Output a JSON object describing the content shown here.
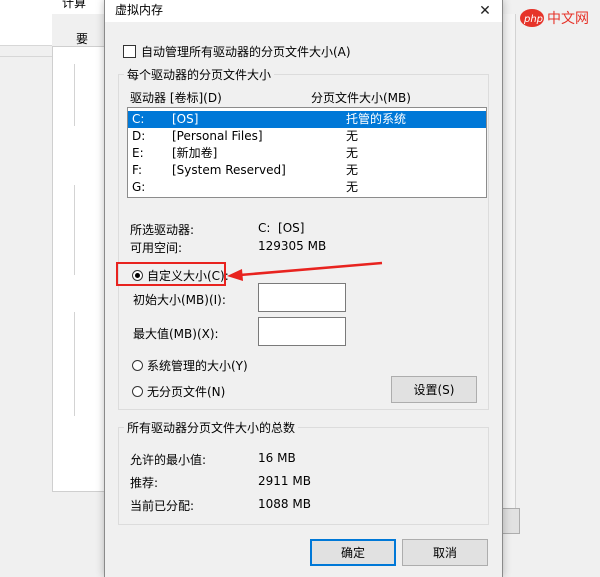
{
  "background_window": {
    "title_fragment": "计算",
    "side_fragment": "要"
  },
  "dialog": {
    "title": "虚拟内存",
    "close_label": "✕",
    "auto_manage": {
      "label": "自动管理所有驱动器的分页文件大小(A)",
      "checked": false
    },
    "per_drive_group": {
      "legend": "每个驱动器的分页文件大小",
      "col_drive": "驱动器 [卷标](D)",
      "col_size": "分页文件大小(MB)",
      "drives": [
        {
          "letter": "C:",
          "label": "[OS]",
          "size": "托管的系统",
          "selected": true
        },
        {
          "letter": "D:",
          "label": "[Personal Files]",
          "size": "无",
          "selected": false
        },
        {
          "letter": "E:",
          "label": "[新加卷]",
          "size": "无",
          "selected": false
        },
        {
          "letter": "F:",
          "label": "[System Reserved]",
          "size": "无",
          "selected": false
        },
        {
          "letter": "G:",
          "label": "",
          "size": "无",
          "selected": false
        }
      ],
      "selected_drive_label": "所选驱动器:",
      "selected_drive_value": "C:  [OS]",
      "free_space_label": "可用空间:",
      "free_space_value": "129305 MB",
      "custom_size_label": "自定义大小(C):",
      "initial_size_label": "初始大小(MB)(I):",
      "initial_size_value": "",
      "max_size_label": "最大值(MB)(X):",
      "max_size_value": "",
      "system_managed_label": "系统管理的大小(Y)",
      "no_paging_label": "无分页文件(N)",
      "set_button": "设置(S)",
      "selected_option": "custom"
    },
    "totals_group": {
      "legend": "所有驱动器分页文件大小的总数",
      "min_allowed_label": "允许的最小值:",
      "min_allowed_value": "16 MB",
      "recommended_label": "推荐:",
      "recommended_value": "2911 MB",
      "allocated_label": "当前已分配:",
      "allocated_value": "1088 MB"
    },
    "ok_button": "确定",
    "cancel_button": "取消"
  },
  "watermark": {
    "text": "php 中文网"
  },
  "colors": {
    "selection": "#0078d7",
    "annotation_red": "#e8231f",
    "watermark_bg": "#e63329"
  }
}
